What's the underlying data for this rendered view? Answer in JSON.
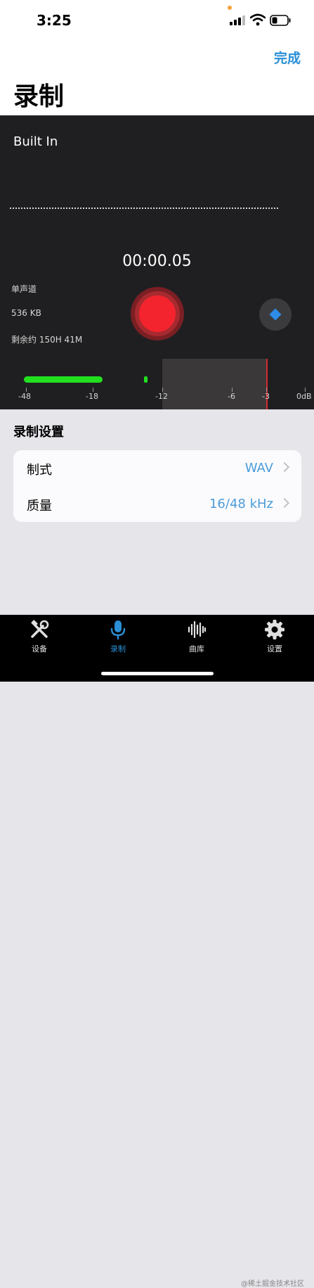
{
  "status": {
    "time": "3:25"
  },
  "nav": {
    "done_label": "完成",
    "title": "录制"
  },
  "recorder": {
    "source": "Built In",
    "timer": "00:00.05",
    "channel": "单声道",
    "file_size": "536 KB",
    "remaining": "剩余约 150H 41M",
    "level_fraction": 0.43,
    "scale": [
      "-48",
      "-18",
      "-12",
      "-6",
      "-3",
      "0dB"
    ]
  },
  "settings": {
    "header": "录制设置",
    "rows": [
      {
        "label": "制式",
        "value": "WAV"
      },
      {
        "label": "质量",
        "value": "16/48 kHz"
      }
    ]
  },
  "tabs": [
    {
      "label": "设备",
      "icon": "tools-icon"
    },
    {
      "label": "录制",
      "icon": "microphone-icon"
    },
    {
      "label": "曲库",
      "icon": "waveform-icon"
    },
    {
      "label": "设置",
      "icon": "gear-icon"
    }
  ],
  "watermark": "@稀土掘金技术社区",
  "colors": {
    "accent": "#2a8fd6",
    "record": "#f4242e",
    "level": "#22e01f",
    "panel": "#1f1f21"
  }
}
